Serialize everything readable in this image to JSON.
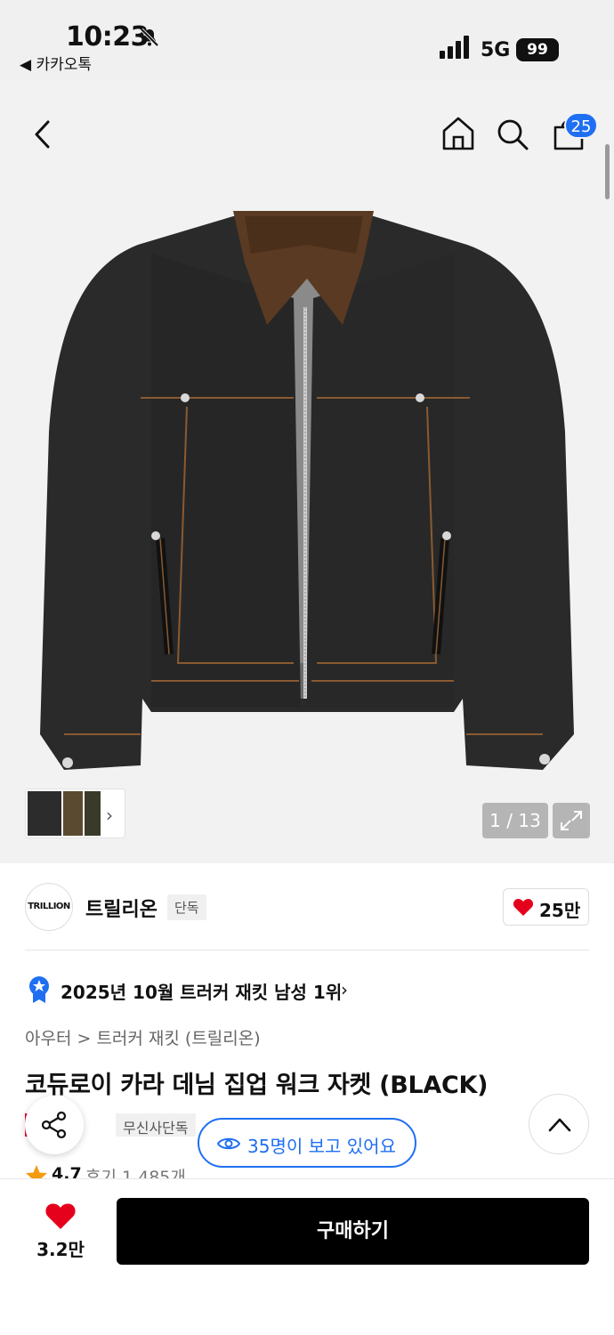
{
  "status_bar": {
    "time": "10:23",
    "back_app": "◀ 카카오톡",
    "network": "5G",
    "battery": "99",
    "icons": [
      "bell-muted-icon",
      "signal-icon"
    ]
  },
  "nav": {
    "icons": [
      "back-icon",
      "home-icon",
      "search-icon",
      "cart-icon"
    ],
    "cart_badge": "25"
  },
  "gallery": {
    "counter": "1 / 13",
    "thumb_arrow": "›",
    "expand_icon": "expand-icon"
  },
  "brand": {
    "logo_text": "TRILLION",
    "name": "트릴리온",
    "tag": "단독",
    "like_count": "25만"
  },
  "ranking": {
    "text": "2025년 10월 트러커 재킷 남성 1위",
    "chevron": "›"
  },
  "breadcrumb": "아우터 > 트러커 재킷 (트릴리온)",
  "product": {
    "title": "코듀로이 카라 데님 집업 워크 자켓 (BLACK)",
    "sale_tag": "세일",
    "exclusive_tag": "무신사단독",
    "rating": "4.7",
    "reviews": "후기 1,485개"
  },
  "viewers": "35명이 보고 있어요",
  "bottom_bar": {
    "like_count": "3.2만",
    "buy_label": "구매하기"
  },
  "colors": {
    "accent_blue": "#1f6ff2",
    "sale_red": "#e4002b",
    "heart_red": "#e5001c",
    "buy_black": "#000000"
  }
}
